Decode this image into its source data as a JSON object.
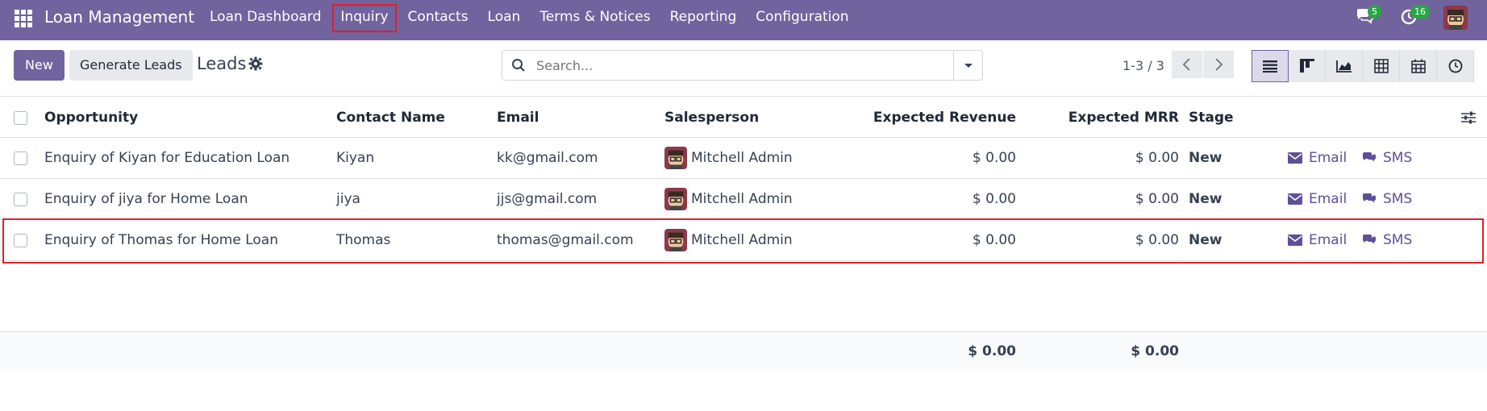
{
  "app": {
    "title": "Loan Management",
    "menu": [
      "Loan Dashboard",
      "Inquiry",
      "Contacts",
      "Loan",
      "Terms & Notices",
      "Reporting",
      "Configuration"
    ],
    "highlighted_menu": "Inquiry",
    "messages_badge": "5",
    "activities_badge": "16"
  },
  "control": {
    "new_label": "New",
    "generate_label": "Generate Leads",
    "page_title": "Leads",
    "search_placeholder": "Search...",
    "pager": "1-3 / 3"
  },
  "table": {
    "headers": {
      "opportunity": "Opportunity",
      "contact": "Contact Name",
      "email": "Email",
      "salesperson": "Salesperson",
      "revenue": "Expected Revenue",
      "mrr": "Expected MRR",
      "stage": "Stage"
    },
    "rows": [
      {
        "opportunity": "Enquiry of Kiyan for Education Loan",
        "contact": "Kiyan",
        "email": "kk@gmail.com",
        "salesperson": "Mitchell Admin",
        "revenue": "$ 0.00",
        "mrr": "$ 0.00",
        "stage": "New",
        "email_action": "Email",
        "sms_action": "SMS"
      },
      {
        "opportunity": "Enquiry of jiya for Home Loan",
        "contact": "jiya",
        "email": "jjs@gmail.com",
        "salesperson": "Mitchell Admin",
        "revenue": "$ 0.00",
        "mrr": "$ 0.00",
        "stage": "New",
        "email_action": "Email",
        "sms_action": "SMS"
      },
      {
        "opportunity": "Enquiry of Thomas for Home Loan",
        "contact": "Thomas",
        "email": "thomas@gmail.com",
        "salesperson": "Mitchell Admin",
        "revenue": "$ 0.00",
        "mrr": "$ 0.00",
        "stage": "New",
        "email_action": "Email",
        "sms_action": "SMS"
      }
    ],
    "totals": {
      "revenue": "$ 0.00",
      "mrr": "$ 0.00"
    }
  },
  "colors": {
    "brand": "#71639e",
    "accent": "#5f4f96",
    "highlight": "#e0202a",
    "badge": "#28a745"
  }
}
